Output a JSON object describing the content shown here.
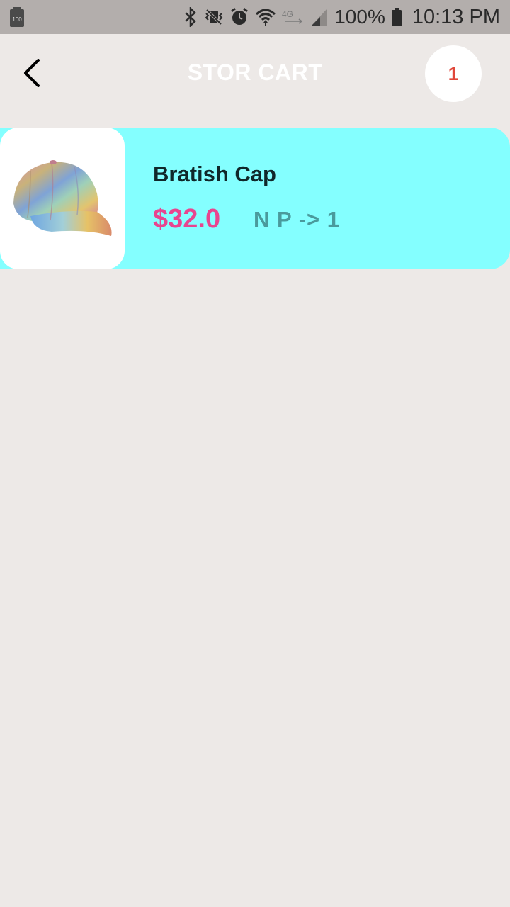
{
  "status_bar": {
    "battery_small_label": "100",
    "battery_percent": "100%",
    "time": "10:13 PM",
    "icons": [
      "battery-icon",
      "bluetooth-icon",
      "vibrate-icon",
      "alarm-icon",
      "wifi-icon",
      "lte-icon",
      "signal-icon",
      "battery-icon"
    ]
  },
  "header": {
    "title": "STOR CART",
    "cart_count": "1",
    "back_icon": "chevron-left-icon"
  },
  "cart": {
    "items": [
      {
        "name": "Bratish Cap",
        "price": "$32.0",
        "quantity_label": "N P -> 1",
        "image": "cap-image"
      }
    ]
  },
  "colors": {
    "background": "#ede9e7",
    "status_bar": "#b3aeac",
    "item_card": "#84ffff",
    "price": "#e8458f",
    "quantity": "#4a9a9c",
    "badge_text": "#e0473a"
  }
}
